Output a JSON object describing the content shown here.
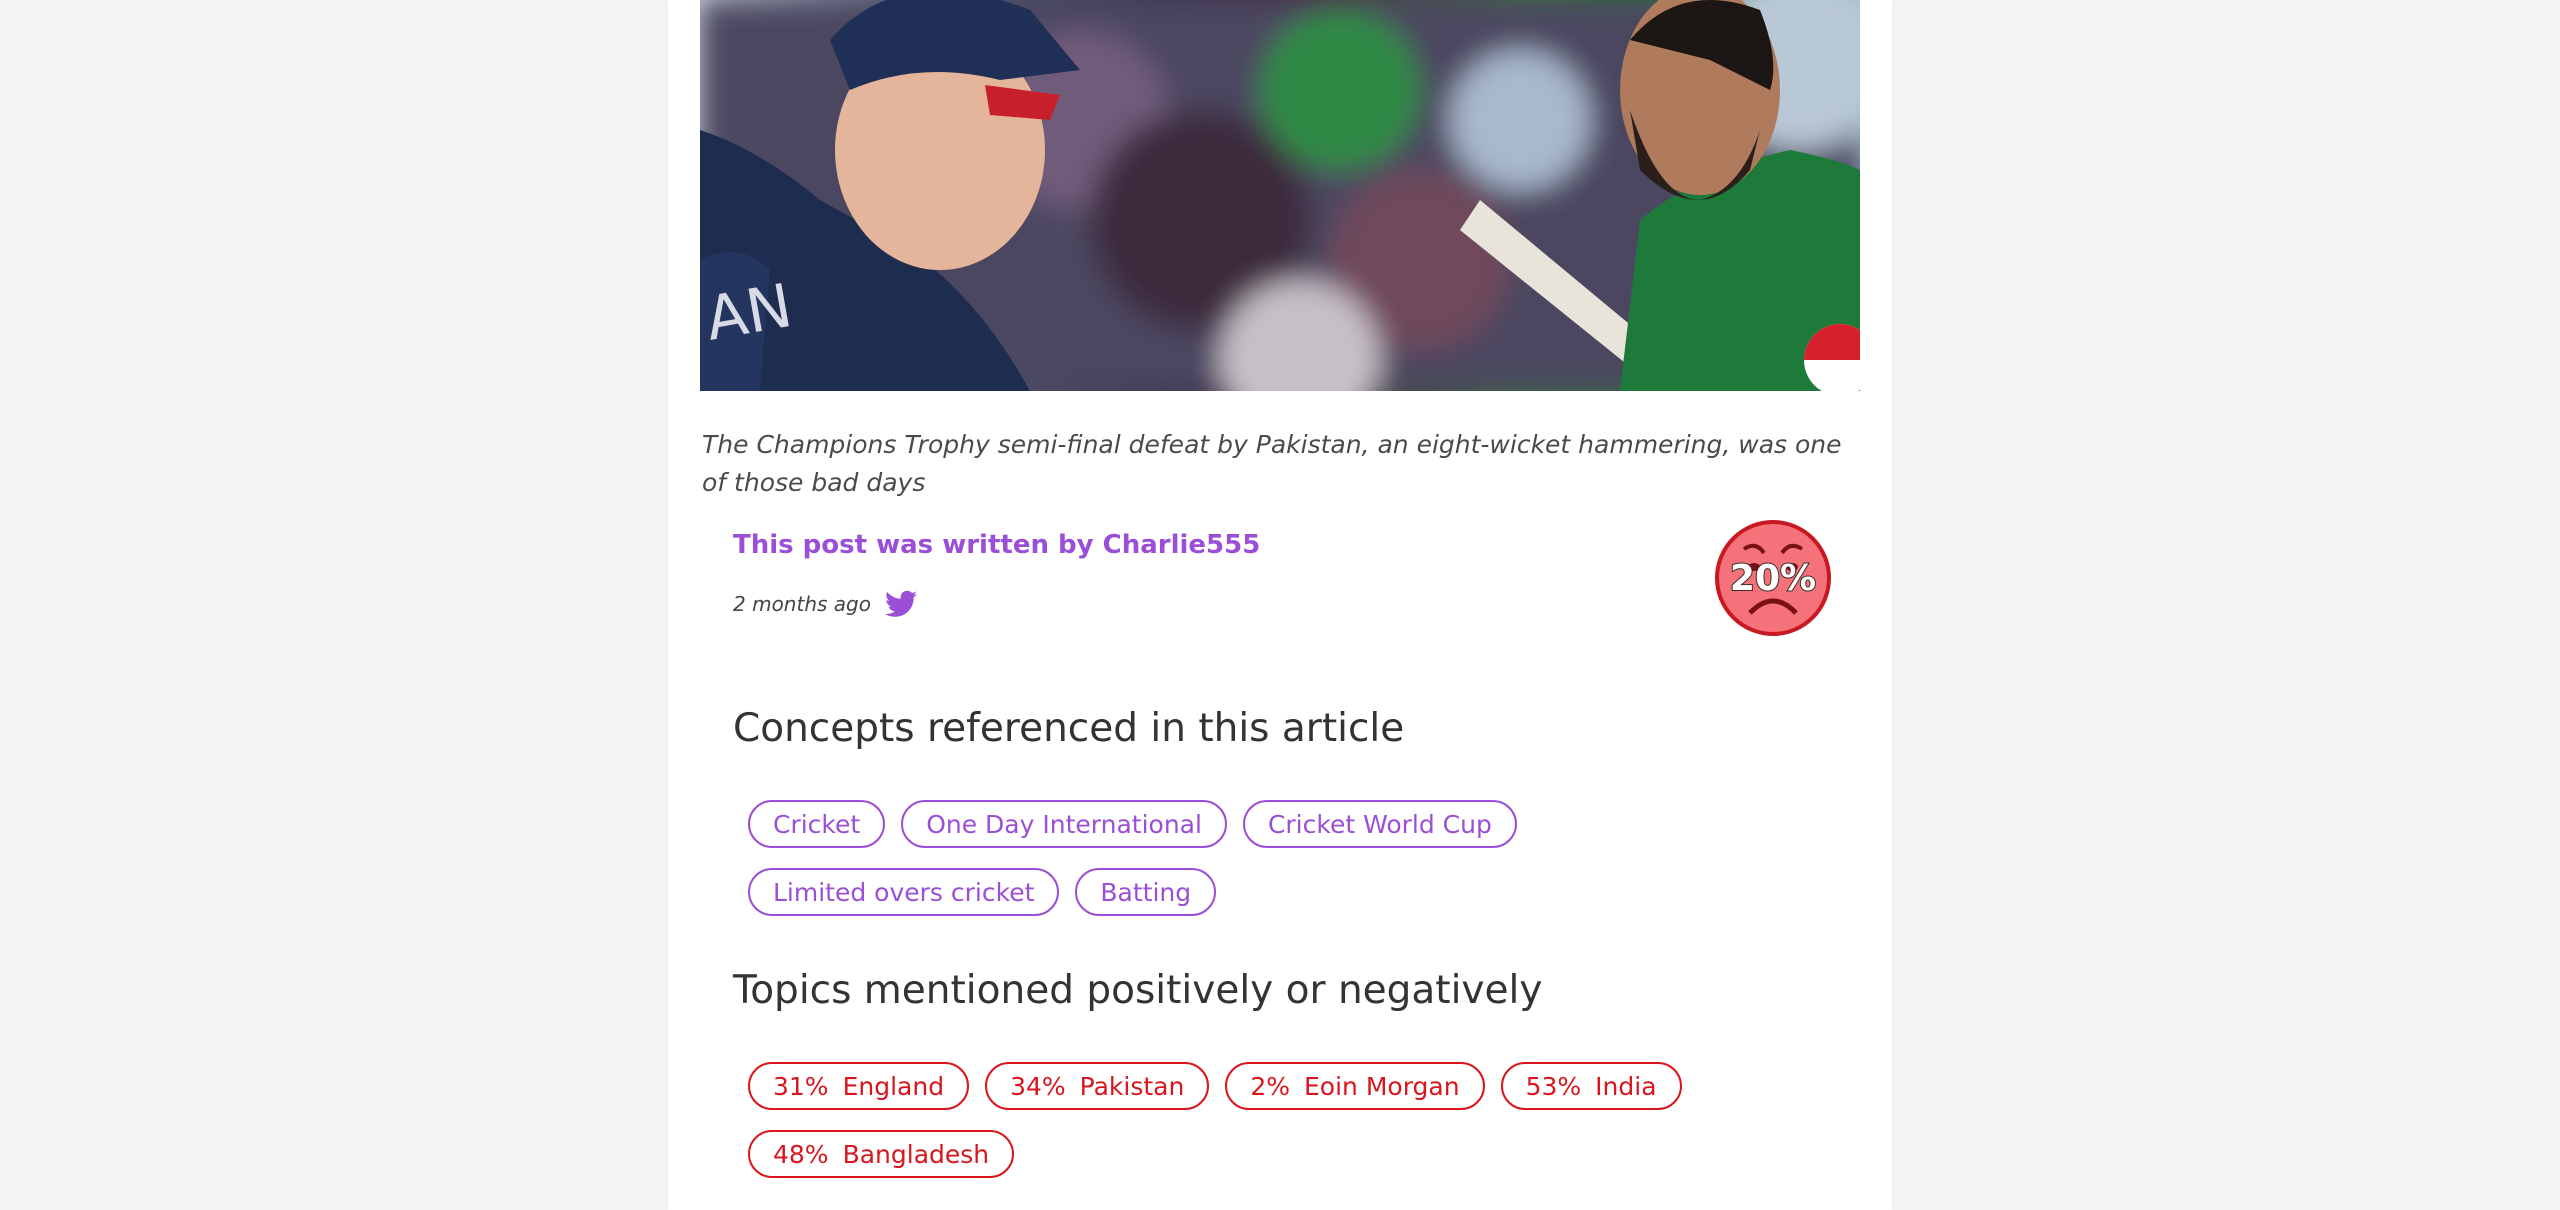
{
  "article": {
    "caption": "The Champions Trophy semi-final defeat by Pakistan, an eight-wicket hammering, was one of those bad days",
    "byline": "This post was written by Charlie555",
    "time_ago": "2 months ago",
    "sentiment_score": "20%",
    "sentiment_icon": "sad-face-icon",
    "share_icon": "twitter-icon"
  },
  "concepts": {
    "title": "Concepts referenced in this article",
    "items": [
      "Cricket",
      "One Day International",
      "Cricket World Cup",
      "Limited overs cricket",
      "Batting"
    ]
  },
  "topics": {
    "title": "Topics mentioned positively or negatively",
    "items": [
      {
        "percent": "31%",
        "label": "England"
      },
      {
        "percent": "34%",
        "label": "Pakistan"
      },
      {
        "percent": "2%",
        "label": "Eoin Morgan"
      },
      {
        "percent": "53%",
        "label": "India"
      },
      {
        "percent": "48%",
        "label": "Bangladesh"
      }
    ]
  },
  "colors": {
    "accent": "#9b4fd6",
    "negative": "#d9161e",
    "background": "#f4f4f4"
  }
}
